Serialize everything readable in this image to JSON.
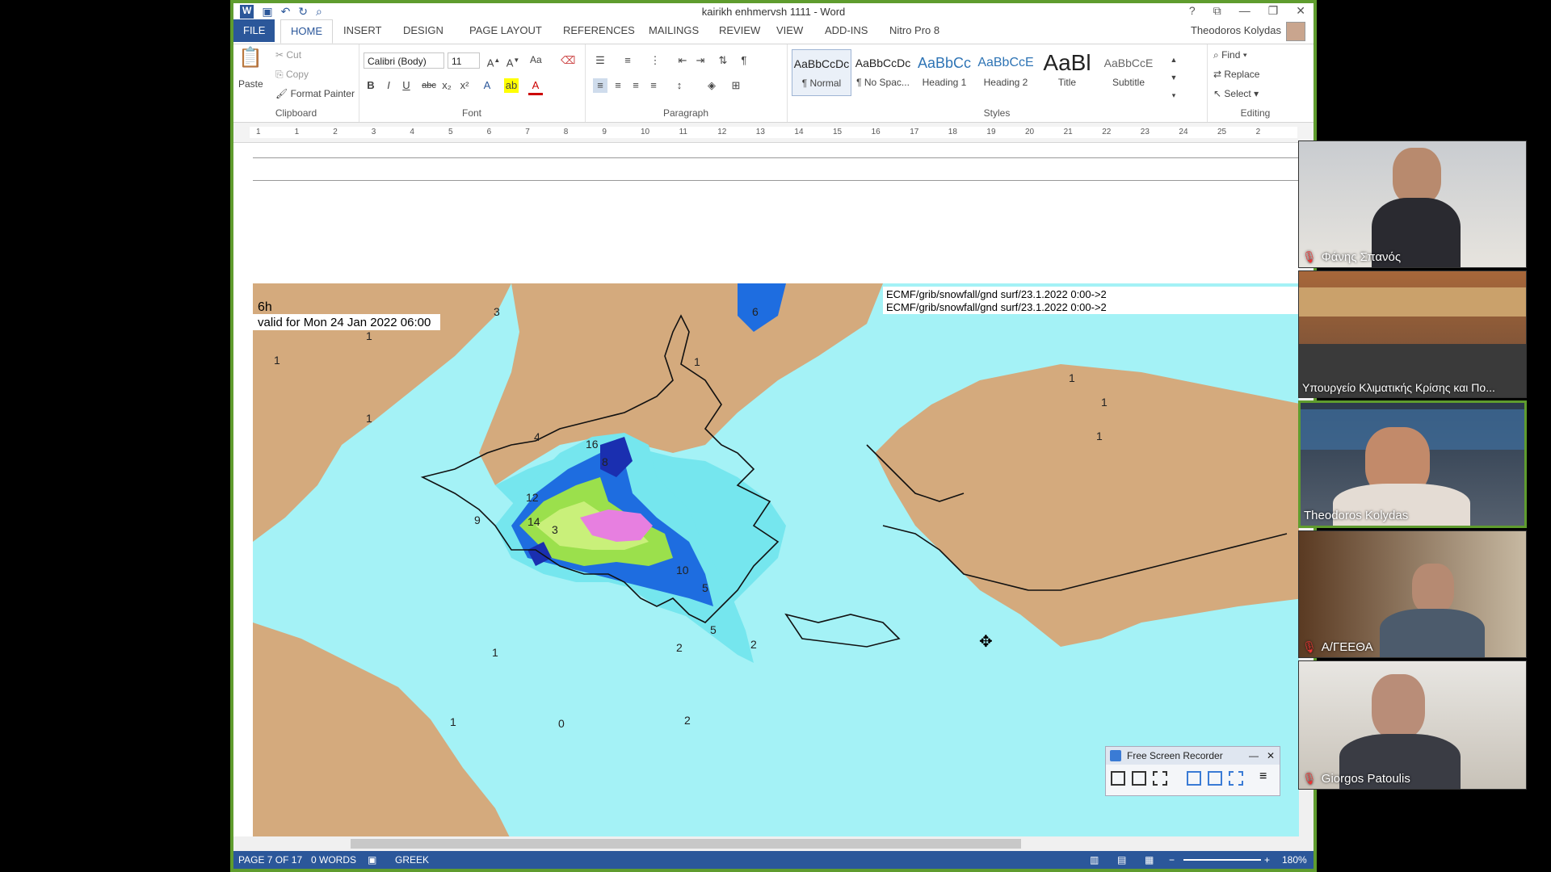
{
  "window": {
    "title": "kairikh enhmervsh 1111 - Word",
    "help": "?",
    "user": "Theodoros Kolydas"
  },
  "tabs": [
    "FILE",
    "HOME",
    "INSERT",
    "DESIGN",
    "PAGE LAYOUT",
    "REFERENCES",
    "MAILINGS",
    "REVIEW",
    "VIEW",
    "ADD-INS",
    "Nitro Pro 8"
  ],
  "ribbon": {
    "clipboard": {
      "paste": "Paste",
      "cut": "Cut",
      "copy": "Copy",
      "format_painter": "Format Painter",
      "label": "Clipboard"
    },
    "font": {
      "name": "Calibri (Body)",
      "size": "11",
      "change_case": "Aa",
      "label": "Font"
    },
    "paragraph": {
      "label": "Paragraph"
    },
    "styles": {
      "items": [
        {
          "preview": "AaBbCcDc",
          "label": "¶ Normal"
        },
        {
          "preview": "AaBbCcDc",
          "label": "¶ No Spac..."
        },
        {
          "preview": "AaBbCc",
          "label": "Heading 1"
        },
        {
          "preview": "AaBbCcE",
          "label": "Heading 2"
        },
        {
          "preview": "AaBl",
          "label": "Title"
        },
        {
          "preview": "AaBbCcE",
          "label": "Subtitle"
        }
      ],
      "label": "Styles"
    },
    "editing": {
      "find": "Find",
      "replace": "Replace",
      "select": "Select",
      "label": "Editing"
    }
  },
  "ruler": {
    "numbers": [
      "1",
      "1",
      "2",
      "3",
      "4",
      "5",
      "6",
      "7",
      "8",
      "9",
      "10",
      "11",
      "12",
      "13",
      "14",
      "15",
      "16",
      "17",
      "18",
      "19",
      "20",
      "21",
      "22",
      "23",
      "24",
      "25",
      "2"
    ]
  },
  "map": {
    "lead": "6h",
    "valid": "valid for Mon 24 Jan 2022 06:00",
    "source_line1": "ECMF/grib/snowfall/gnd surf/23.1.2022 0:00->2",
    "source_line2": "ECMF/grib/snowfall/gnd surf/23.1.2022 0:00->2",
    "contour_labels": [
      {
        "t": "3"
      },
      {
        "t": "6"
      },
      {
        "t": "1"
      },
      {
        "t": "1"
      },
      {
        "t": "1"
      },
      {
        "t": "1"
      },
      {
        "t": "4"
      },
      {
        "t": "16"
      },
      {
        "t": "8"
      },
      {
        "t": "12"
      },
      {
        "t": "14"
      },
      {
        "t": "9"
      },
      {
        "t": "3"
      },
      {
        "t": "10"
      },
      {
        "t": "5"
      },
      {
        "t": "5"
      },
      {
        "t": "2"
      },
      {
        "t": "2"
      },
      {
        "t": "1"
      },
      {
        "t": "0"
      },
      {
        "t": "2"
      },
      {
        "t": "1"
      },
      {
        "t": "1"
      },
      {
        "t": "1"
      },
      {
        "t": "1"
      }
    ],
    "colors": {
      "land": "#d4aa7d",
      "sea_light": "#a4f2f6",
      "sea_dark": "#75e6ee",
      "blue": "#1e6de0",
      "navy": "#1a2fb0",
      "green": "#9be04c",
      "lime": "#c9f07a",
      "magenta": "#e77fe0"
    }
  },
  "status": {
    "page": "PAGE 7 OF 17",
    "words": "0 WORDS",
    "language": "GREEK",
    "zoom": "180%"
  },
  "participants": [
    {
      "name": "Φάνης Σπανός",
      "muted": true
    },
    {
      "name": "Υπουργείο Κλιματικής Κρίσης και Πο...",
      "muted": false
    },
    {
      "name": "Theodoros Kolydas",
      "muted": false
    },
    {
      "name": "Α/ΓΕΕΘΑ",
      "muted": true
    },
    {
      "name": "Giorgos Patoulis",
      "muted": true
    }
  ],
  "recorder": {
    "title": "Free Screen Recorder"
  }
}
